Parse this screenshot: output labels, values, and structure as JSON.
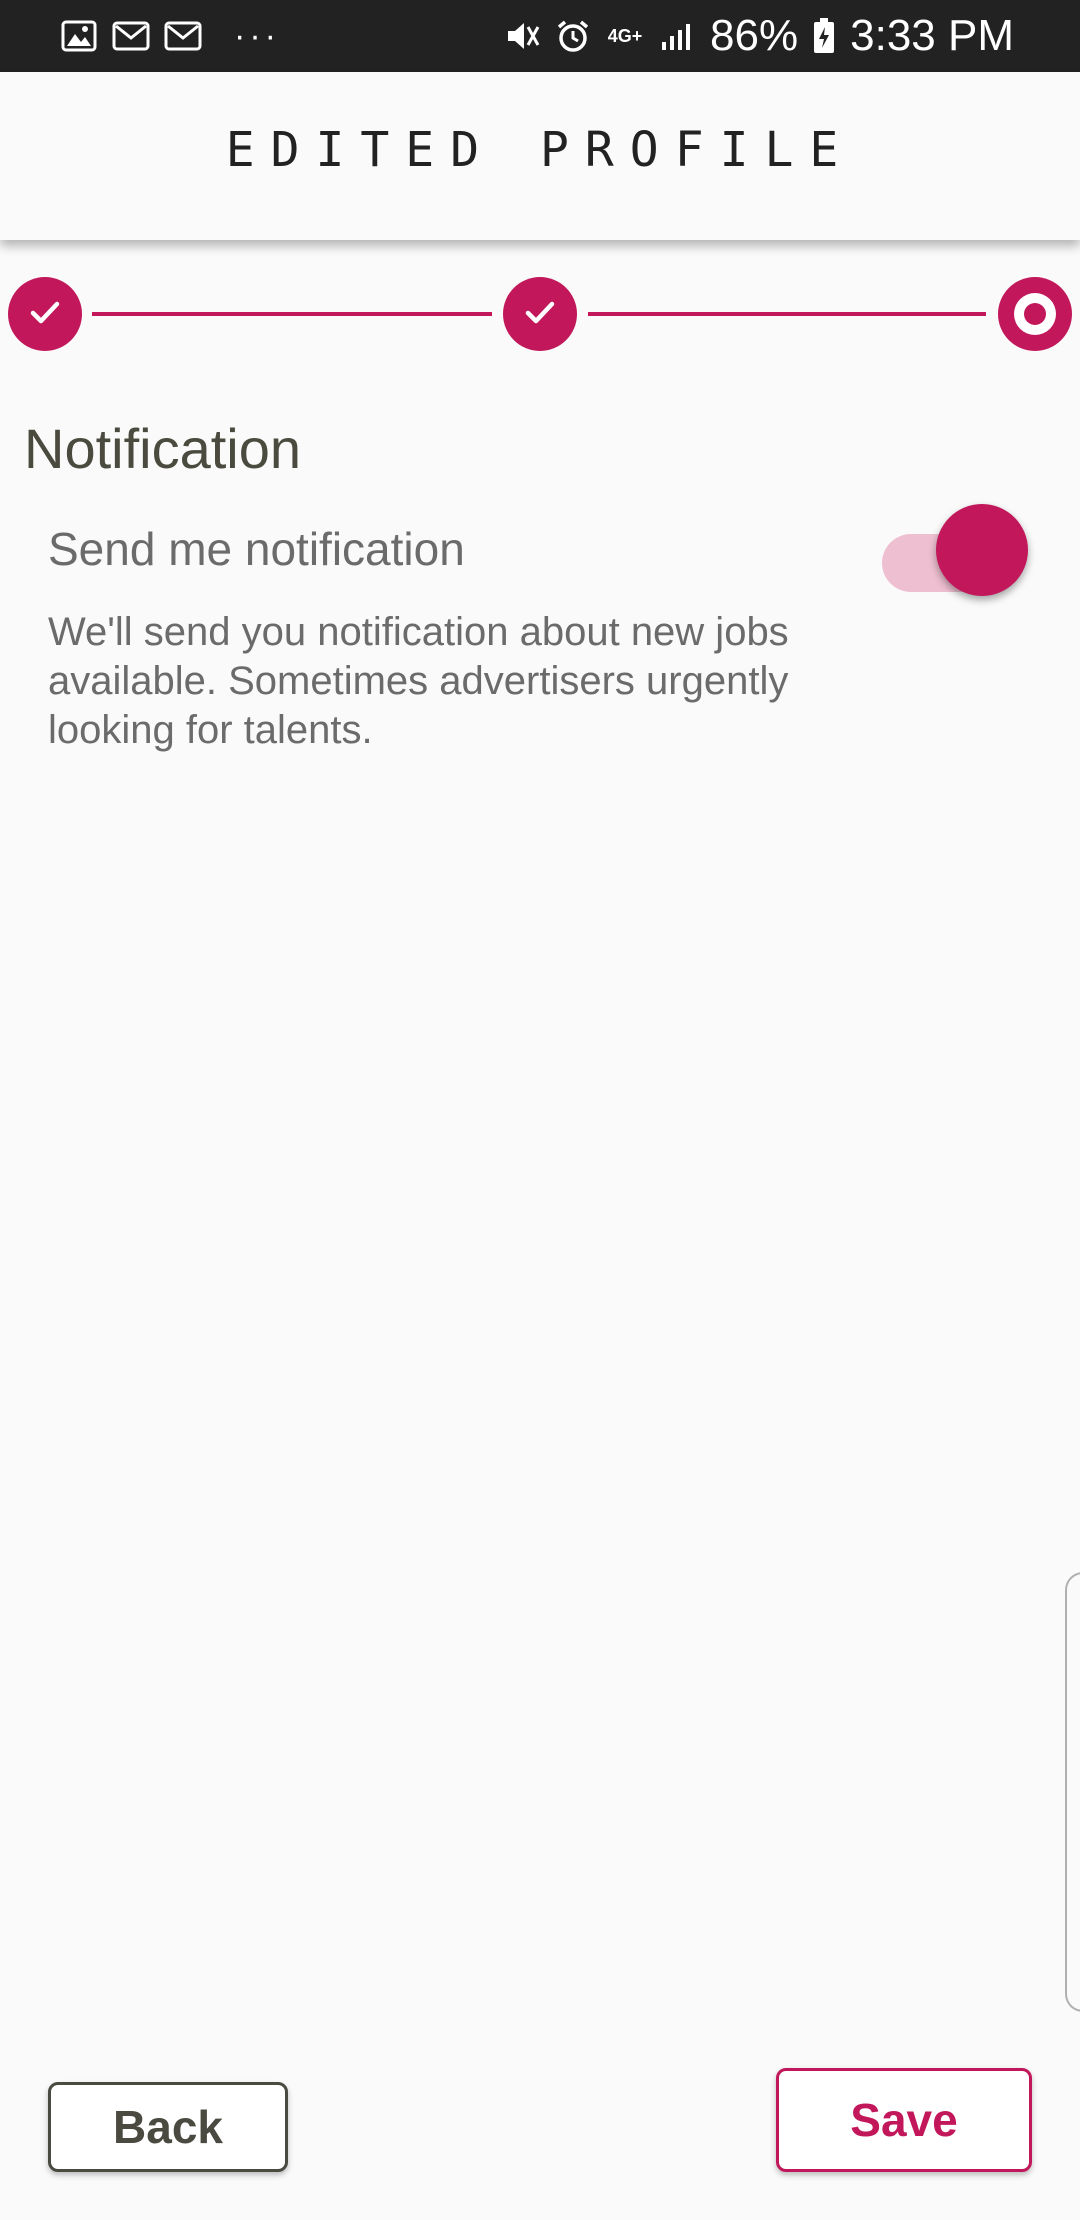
{
  "colors": {
    "accent": "#c2185b",
    "accent_light": "#eebfd0",
    "status_bar": "#222222",
    "background": "#fafafa",
    "text_dark": "#4a4a3e",
    "text_muted": "#6b6b6b"
  },
  "status_bar": {
    "left_icons": [
      "image-icon",
      "gmail-icon",
      "gmail-icon"
    ],
    "more": "···",
    "right_icons": [
      "vibrate-mute-icon",
      "alarm-icon",
      "network-4g-icon",
      "signal-icon",
      "battery-charging-icon"
    ],
    "network": "4G+",
    "battery": "86%",
    "time": "3:33 PM"
  },
  "header": {
    "title": "EDITED PROFILE"
  },
  "stepper": {
    "total_steps": 3,
    "current_step": 3,
    "steps": [
      {
        "state": "completed",
        "icon": "check-icon"
      },
      {
        "state": "completed",
        "icon": "check-icon"
      },
      {
        "state": "current",
        "icon": "radio-dot-icon"
      }
    ]
  },
  "notification": {
    "section_title": "Notification",
    "toggle_label": "Send me notification",
    "toggle_on": true,
    "description": "We'll send you notification about new jobs available. Sometimes advertisers urgently looking for talents."
  },
  "actions": {
    "back_label": "Back",
    "save_label": "Save"
  }
}
